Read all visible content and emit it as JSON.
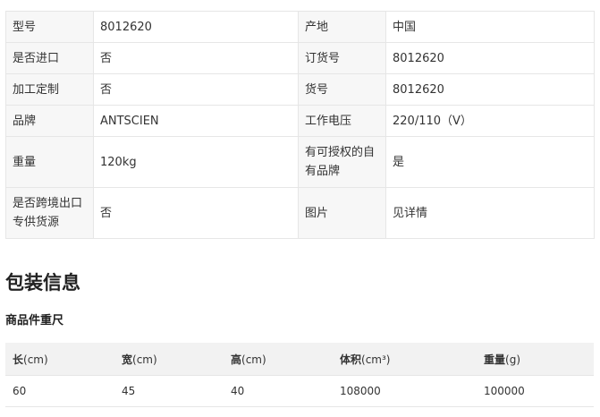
{
  "specs": {
    "rows": [
      {
        "k1": "型号",
        "v1": "8012620",
        "k2": "产地",
        "v2": "中国"
      },
      {
        "k1": "是否进口",
        "v1": "否",
        "k2": "订货号",
        "v2": "8012620"
      },
      {
        "k1": "加工定制",
        "v1": "否",
        "k2": "货号",
        "v2": "8012620"
      },
      {
        "k1": "品牌",
        "v1": "ANTSCIEN",
        "k2": "工作电压",
        "v2": "220/110（V）"
      },
      {
        "k1": "重量",
        "v1": "120kg",
        "k2": "有可授权的自有品牌",
        "v2": "是"
      },
      {
        "k1": "是否跨境出口专供货源",
        "v1": "否",
        "k2": "图片",
        "v2": "见详情"
      }
    ]
  },
  "package": {
    "title": "包装信息",
    "subtitle": "商品件重尺",
    "headers": [
      {
        "label": "长",
        "unit": "(cm)"
      },
      {
        "label": "宽",
        "unit": "(cm)"
      },
      {
        "label": "高",
        "unit": "(cm)"
      },
      {
        "label": "体积",
        "unit": "(cm³)"
      },
      {
        "label": "重量",
        "unit": "(g)"
      }
    ],
    "row": [
      "60",
      "45",
      "40",
      "108000",
      "100000"
    ]
  }
}
